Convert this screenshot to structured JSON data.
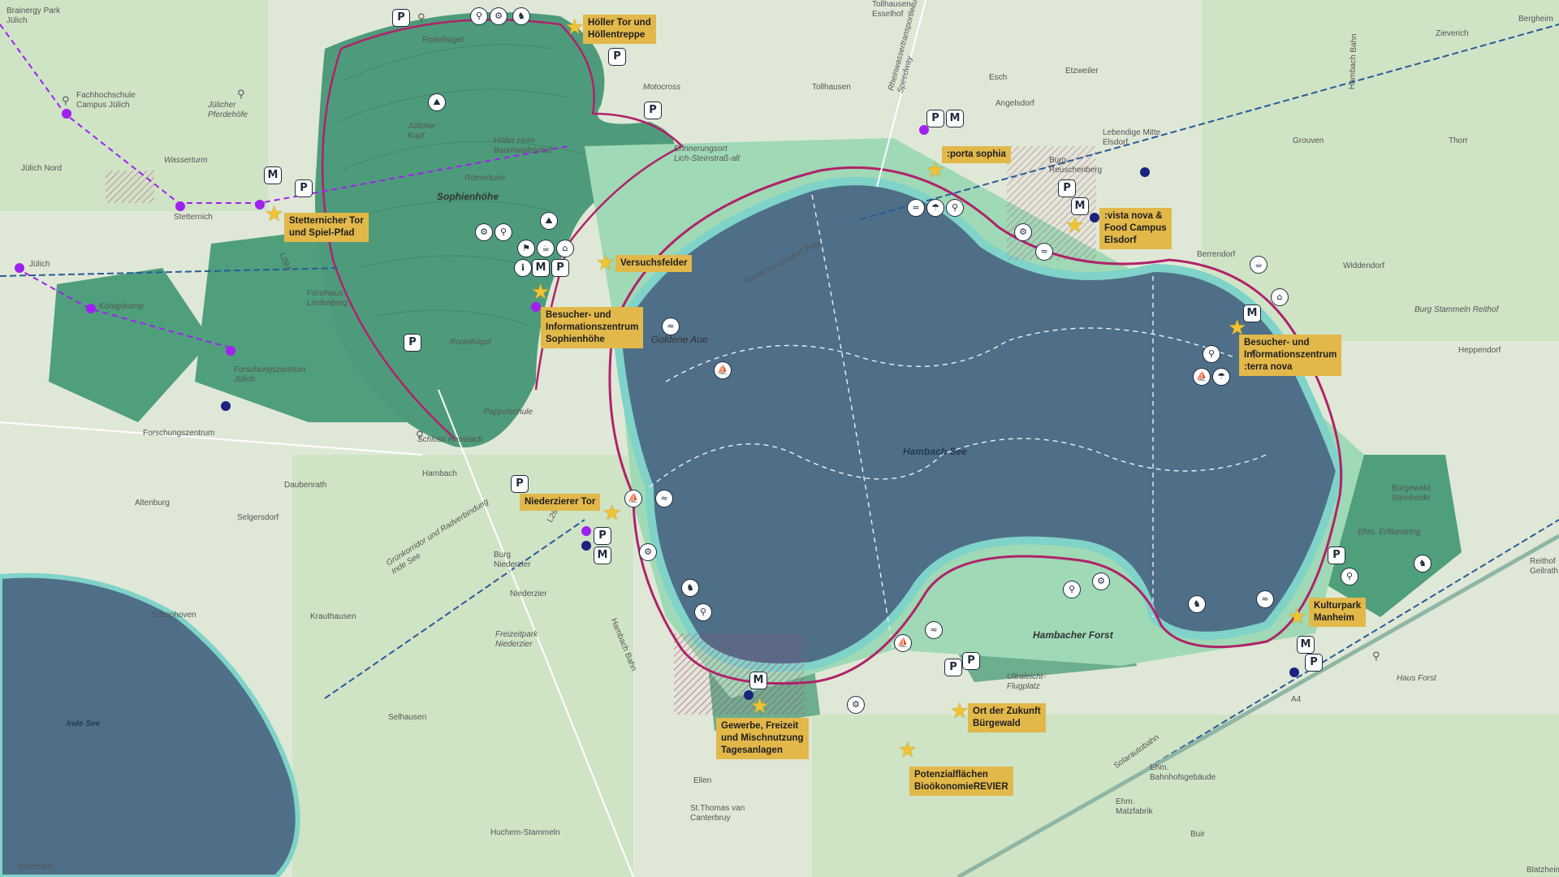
{
  "colors": {
    "lake": "#4f6f88",
    "shore": "#7fd3c8",
    "forest": "#4f9f7c",
    "green": "#6fc49a",
    "route": "#b0226b",
    "rail": "#2a5b9a",
    "callout": "#e2b84a",
    "poi_purple": "#a020f0",
    "poi_blue": "#1a237e"
  },
  "lakes": {
    "hambach": "Hambach See",
    "inde": "Inde See"
  },
  "areas": {
    "sophienhoehe": "Sophienhöhe",
    "hambacher_forst": "Hambacher Forst",
    "goldene_aue": "Goldene Aue"
  },
  "callouts": {
    "hoeller_tor": [
      "Höller Tor und",
      "Höllentreppe"
    ],
    "stetternicher_tor": [
      "Stetternicher Tor",
      "und Spiel-Pfad"
    ],
    "versuchsfelder": [
      "Versuchsfelder"
    ],
    "zentrum_sophienhoehe": [
      "Besucher- und",
      "Informationszentrum",
      "Sophienhöhe"
    ],
    "porta_sophia": [
      ":porta sophia"
    ],
    "vista_nova": [
      ":vista nova &",
      "Food Campus",
      "Elsdorf"
    ],
    "terra_nova": [
      "Besucher- und",
      "Informationszentrum",
      ":terra nova"
    ],
    "niederzierer_tor": [
      "Niederzierer Tor"
    ],
    "kulturpark": [
      "Kulturpark",
      "Manheim"
    ],
    "gewerbe": [
      "Gewerbe, Freizeit",
      "und Mischnutzung",
      "Tagesanlagen"
    ],
    "ort_zukunft": [
      "Ort der Zukunft",
      "Bürgewald"
    ],
    "potenzialflaechen": [
      "Potenzialflächen",
      "BioökonomieREVIER"
    ]
  },
  "places": {
    "brainergy": [
      "Brainergy Park",
      "Jülich"
    ],
    "fachhochschule": [
      "Fachhochschule",
      "Campus Jülich"
    ],
    "juelicher_pferdehoefe": [
      "Jülicher",
      "Pferdehöfe"
    ],
    "wasserturm": [
      "Wasserturm"
    ],
    "juelich_nord": [
      "Jülich Nord"
    ],
    "stetternich": [
      "Stetternich"
    ],
    "juelich": [
      "Jülich"
    ],
    "koenigskamp": [
      "Königskamp"
    ],
    "forsthaus": [
      "Forsthaus",
      "Lindenberg"
    ],
    "forschungszentrum_juelich": [
      "Forschungszentrum",
      "Jülich"
    ],
    "forschungszentrum": [
      "Forschungszentrum"
    ],
    "schloss_hambach": [
      "Schloss Hambach"
    ],
    "hambach": [
      "Hambach"
    ],
    "daubenrath": [
      "Daubenrath"
    ],
    "altenburg": [
      "Altenburg"
    ],
    "selgersdorf": [
      "Selgersdorf"
    ],
    "schophoven": [
      "Schophoven"
    ],
    "krauthausen": [
      "Krauthausen"
    ],
    "burg_niederzier": [
      "Burg",
      "Niederzier"
    ],
    "niederzier": [
      "Niederzier"
    ],
    "freizeitpark": [
      "Freizeitpark",
      "Niederzier"
    ],
    "selhausen": [
      "Selhausen"
    ],
    "ellen": [
      "Ellen"
    ],
    "st_thomas": [
      "St.Thomas van",
      "Canterbruy"
    ],
    "huchem": [
      "Huchem-Stammeln"
    ],
    "indemann": [
      "Indemann"
    ],
    "rodelhuegel_top": [
      "Rodelhügel"
    ],
    "rodelhuegel_bottom": [
      "Rodelhügel"
    ],
    "juelicher_kopf": [
      "Jülicher",
      "Kopf"
    ],
    "hoeller_horn": [
      "Höller Horn",
      "Baumwipfelpfad"
    ],
    "roemerturm": [
      "Römerturm"
    ],
    "pappelschule": [
      "Pappelschule"
    ],
    "motocross": [
      "Motocross"
    ],
    "erinnerungsort": [
      "Erinnerungsort",
      "Lich-Steinstraß-alt"
    ],
    "niederzier_elsdorf": [
      "Niederzier-Elsdorf-Trog"
    ],
    "tollhausen": [
      "Tollhausen"
    ],
    "tollhaus_top": [
      "Tollhausen",
      "Esselhof"
    ],
    "rheinwasser": [
      "Rheinwassertransportleitung",
      "Speedway"
    ],
    "esch": [
      "Esch"
    ],
    "etzweiler": [
      "Etzweiler"
    ],
    "angelsdorf": [
      "Angelsdorf"
    ],
    "lebendige_mitte": [
      "Lebendige Mitte",
      "Elsdorf"
    ],
    "burg_reuschenberg": [
      "Burg",
      "Reuschenberg"
    ],
    "grouven": [
      "Grouven"
    ],
    "thorr": [
      "Thorr"
    ],
    "zieverich": [
      "Zieverich"
    ],
    "bergheim": [
      "Bergheim"
    ],
    "berrendorf": [
      "Berrendorf"
    ],
    "widdendorf": [
      "Widdendorf"
    ],
    "burg_stammeln": [
      "Burg Stammeln Reithof"
    ],
    "heppendorf": [
      "Heppendorf"
    ],
    "hambach_bahn_right": [
      "Hambach Bahn"
    ],
    "buergewald_steinheide": [
      "Bürgewald",
      "Steinheide"
    ],
    "erftlandring": [
      "Ehm. Erftlandring"
    ],
    "reithof": [
      "Reithof",
      "Geilrath"
    ],
    "haus_forst": [
      "Haus Forst"
    ],
    "ultraleicht": [
      "Ultraleicht-",
      "Flugplatz"
    ],
    "solarautobahn": [
      "Solarautobahn"
    ],
    "bahnhofsgebaeude": [
      "Ehm.",
      "Bahnhofsgebäude"
    ],
    "malzfabrik": [
      "Ehm.",
      "Malzfabrik"
    ],
    "buir": [
      "Buir"
    ],
    "blatzheim": [
      "Blatzheim"
    ],
    "a4": [
      "A4"
    ],
    "l264": [
      "L264"
    ],
    "l284": [
      "L284"
    ],
    "gruenkorridor": [
      "Grünkorridor und Radverbindung",
      "Inde See"
    ],
    "hambach_bahn_left": [
      "Hambach Bahn"
    ]
  }
}
